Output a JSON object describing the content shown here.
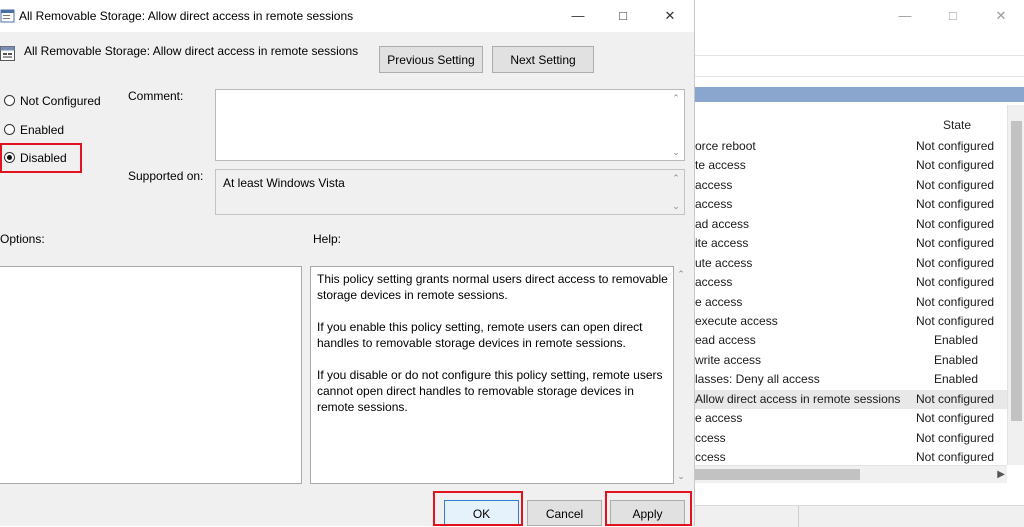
{
  "dialog": {
    "title": "All Removable Storage: Allow direct access in remote sessions",
    "policy_name": "All Removable Storage: Allow direct access in remote sessions",
    "previous_setting_label": "Previous Setting",
    "next_setting_label": "Next Setting",
    "radios": [
      {
        "label": "Not Configured",
        "selected": false
      },
      {
        "label": "Enabled",
        "selected": false
      },
      {
        "label": "Disabled",
        "selected": true
      }
    ],
    "comment_label": "Comment:",
    "comment_value": "",
    "supported_on_label": "Supported on:",
    "supported_on_value": "At least Windows Vista",
    "options_label": "Options:",
    "help_label": "Help:",
    "help_paragraphs": [
      "This policy setting grants normal users direct access to removable storage devices in remote sessions.",
      "If you enable this policy setting, remote users can open direct handles to removable storage devices in remote sessions.",
      "If you disable or do not configure this policy setting, remote users cannot open direct handles to removable storage devices in remote sessions."
    ],
    "ok_label": "OK",
    "cancel_label": "Cancel",
    "apply_label": "Apply",
    "highlight_color": "#e0131f",
    "focus_color": "#2f7fd8"
  },
  "background_window": {
    "column_state": "State",
    "rows": [
      {
        "name": "orce reboot",
        "state": "Not configured"
      },
      {
        "name": "te access",
        "state": "Not configured"
      },
      {
        "name": "access",
        "state": "Not configured"
      },
      {
        "name": "access",
        "state": "Not configured"
      },
      {
        "name": "ad access",
        "state": "Not configured"
      },
      {
        "name": "ite access",
        "state": "Not configured"
      },
      {
        "name": "ute access",
        "state": "Not configured"
      },
      {
        "name": " access",
        "state": "Not configured"
      },
      {
        "name": "e access",
        "state": "Not configured"
      },
      {
        "name": "execute access",
        "state": "Not configured"
      },
      {
        "name": "ead access",
        "state": "Enabled"
      },
      {
        "name": "write access",
        "state": "Enabled"
      },
      {
        "name": "lasses: Deny all access",
        "state": "Enabled"
      },
      {
        "name": "Allow direct access in remote sessions",
        "state": "Not configured",
        "selected": true
      },
      {
        "name": "e access",
        "state": "Not configured"
      },
      {
        "name": "ccess",
        "state": "Not configured"
      },
      {
        "name": "ccess",
        "state": "Not configured"
      }
    ]
  }
}
